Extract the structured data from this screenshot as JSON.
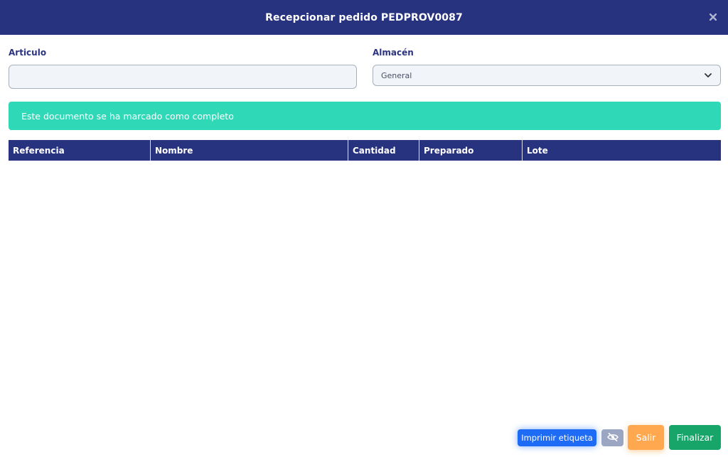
{
  "header": {
    "title": "Recepcionar pedido PEDPROV0087",
    "close_icon": "close-icon"
  },
  "form": {
    "articulo_label": "Articulo",
    "articulo_value": "",
    "almacen_label": "Almacén",
    "almacen_selected": "General"
  },
  "alert": {
    "text": "Este documento se ha marcado como completo",
    "color": "#2fd8b6"
  },
  "table": {
    "columns": [
      "Referencia",
      "Nombre",
      "Cantidad",
      "Preparado",
      "Lote"
    ],
    "rows": []
  },
  "footer": {
    "print_label": "Imprimir etiqueta",
    "eye_icon": "eye-off-icon",
    "salir_label": "Salir",
    "finalizar_label": "Finalizar"
  },
  "colors": {
    "header_bg": "#283380",
    "print_btn": "#1e6cf5",
    "eye_btn": "#9aa6c2",
    "salir_btn": "#ffa84f",
    "finalizar_btn": "#17a56a"
  }
}
